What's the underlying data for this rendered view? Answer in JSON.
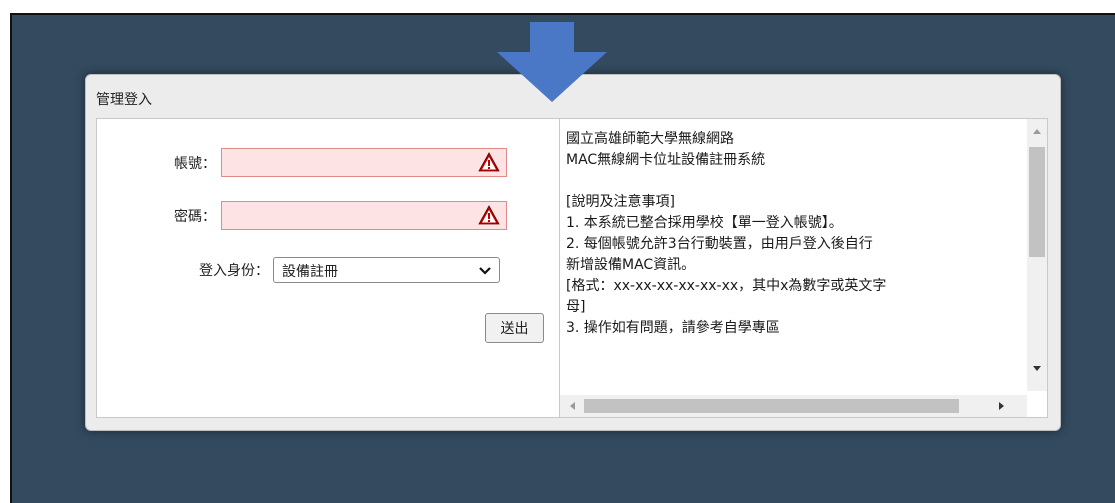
{
  "dialog": {
    "title": "管理登入"
  },
  "form": {
    "account_label": "帳號：",
    "account_value": "",
    "password_label": "密碼：",
    "password_value": "",
    "role_label": "登入身份：",
    "role_selected": "設備註冊",
    "submit_label": "送出"
  },
  "info": {
    "lines": [
      "國立高雄師範大學無線網路",
      "MAC無線網卡位址設備註冊系統",
      "",
      "[說明及注意事項]",
      "1. 本系統已整合採用學校【單一登入帳號】。",
      "2. 每個帳號允許3台行動裝置，由用戶登入後自行",
      "新增設備MAC資訊。",
      "[格式：xx-xx-xx-xx-xx-xx，其中x為數字或英文字",
      "母]",
      "3. 操作如有問題，請參考自學專區"
    ]
  },
  "colors": {
    "background": "#334a5f",
    "arrow": "#4a78c6",
    "field_error_bg": "#fde3e3",
    "field_error_border": "#e08a8a",
    "warning_red": "#c00000"
  },
  "icons": {
    "arrow": "down-arrow-icon",
    "warning": "warning-icon",
    "chevron": "chevron-down-icon"
  }
}
